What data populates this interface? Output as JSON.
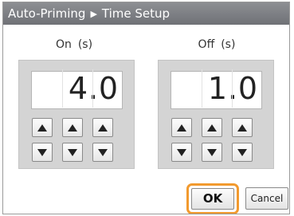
{
  "dialog": {
    "title_main": "Auto-Priming",
    "title_sep": "▶",
    "title_sub": "Time Setup"
  },
  "on_group": {
    "label": "On",
    "unit": "(s)",
    "digits": [
      "",
      "4",
      "0"
    ],
    "dot": "."
  },
  "off_group": {
    "label": "Off",
    "unit": "(s)",
    "digits": [
      "",
      "1",
      "0"
    ],
    "dot": "."
  },
  "buttons": {
    "ok_label": "OK",
    "cancel_label": "Cancel"
  },
  "icons": [
    "up-arrow-icon",
    "down-arrow-icon"
  ],
  "colors": {
    "title_bar": "#7e8085",
    "panel_bg": "#d4d4d4",
    "ok_highlight": "#f29a2e"
  }
}
